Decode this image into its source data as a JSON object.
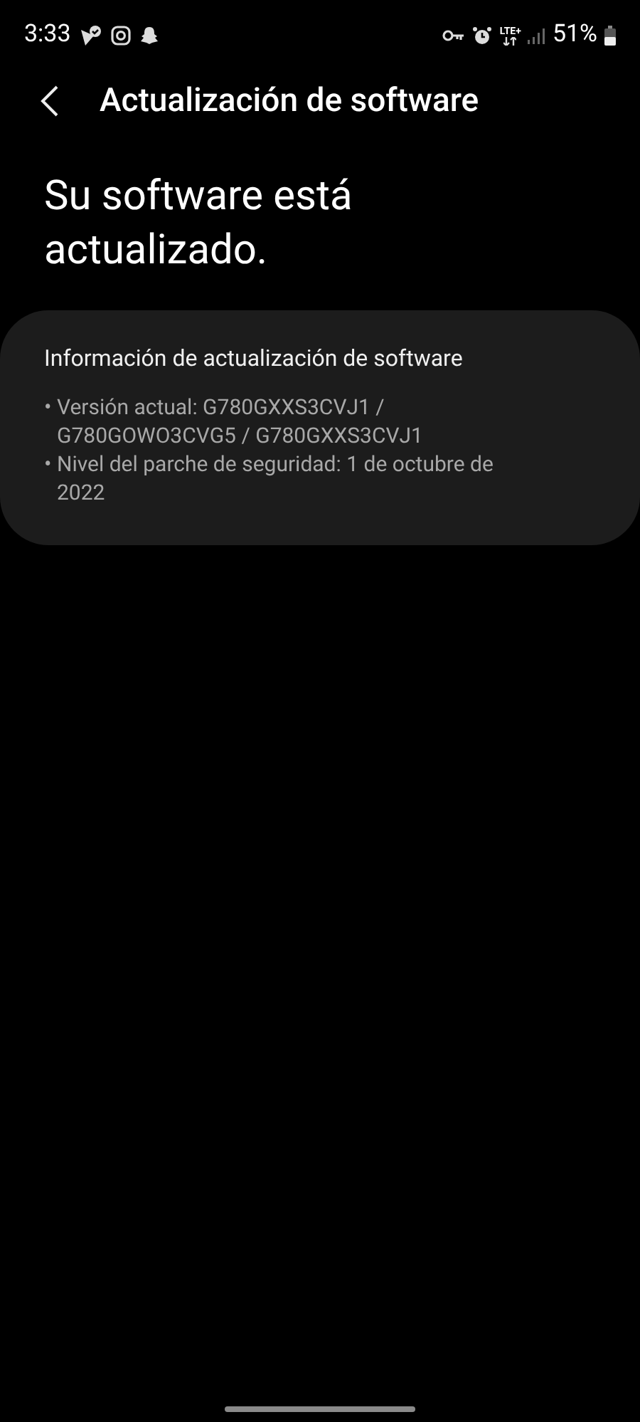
{
  "status_bar": {
    "time": "3:33",
    "network": "LTE+",
    "battery": "51%"
  },
  "header": {
    "title": "Actualización de software"
  },
  "status_message": "Su software está actualizado.",
  "info_card": {
    "title": "Información de actualización de software",
    "items": [
      {
        "bullet": "•",
        "text": "Versión actual: G780GXXS3CVJ1 / G780GOWO3CVG5 / G780GXXS3CVJ1"
      },
      {
        "bullet": "•",
        "text": "Nivel del parche de seguridad: 1 de octubre de 2022"
      }
    ]
  }
}
